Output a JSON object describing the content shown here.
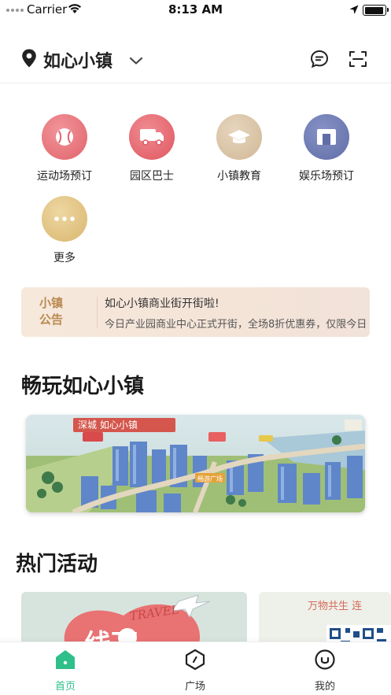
{
  "status_bar": {
    "carrier": "Carrier",
    "time": "8:13 AM",
    "battery_level": 0.95
  },
  "header": {
    "title": "如心小镇"
  },
  "quick_entries": [
    {
      "label": "运动场预订",
      "icon": "ball-icon",
      "color": "#e56f76"
    },
    {
      "label": "园区巴士",
      "icon": "bus-icon",
      "color": "#e5626b"
    },
    {
      "label": "小镇教育",
      "icon": "graduation-cap-icon",
      "color": "#d9c3a4"
    },
    {
      "label": "娱乐场预订",
      "icon": "stage-icon",
      "color": "#6d7bb0"
    },
    {
      "label": "更多",
      "icon": "more-icon",
      "color": "#e3c584"
    }
  ],
  "notice": {
    "tag_line1": "小镇",
    "tag_line2": "公告",
    "title": "如心小镇商业街开街啦!",
    "text": "今日产业园商业中心正式开街，全场8折优惠券，仅限今日"
  },
  "section_play": {
    "title": "畅玩如心小镇"
  },
  "banner": {
    "sign_text": "深城 如心小镇",
    "badge_text": "畅游广场"
  },
  "section_activity": {
    "title": "热门活动"
  },
  "activities": [
    {
      "overlay_text": "TRAVEL",
      "headline": "线下"
    },
    {
      "overlay_text": "万物共生 连"
    }
  ],
  "tabbar": {
    "items": [
      {
        "label": "首页",
        "icon": "home-icon",
        "active": true
      },
      {
        "label": "广场",
        "icon": "square-icon",
        "active": false
      },
      {
        "label": "我的",
        "icon": "profile-icon",
        "active": false
      }
    ]
  },
  "colors": {
    "accent": "#2fbf8a",
    "notice_tag": "#b98a4f"
  }
}
